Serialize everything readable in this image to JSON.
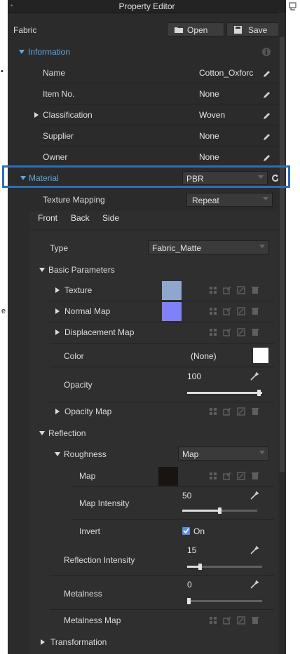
{
  "title": "Property Editor",
  "fabric_label": "Fabric",
  "open_label": "Open",
  "save_label": "Save",
  "information": {
    "header": "Information",
    "fields": [
      {
        "label": "Name",
        "value": "Cotton_Oxforc"
      },
      {
        "label": "Item No.",
        "value": "None"
      },
      {
        "label": "Classification",
        "value": "Woven"
      },
      {
        "label": "Supplier",
        "value": "None"
      },
      {
        "label": "Owner",
        "value": "None"
      }
    ]
  },
  "material": {
    "header": "Material",
    "value": "PBR",
    "texture_mapping_label": "Texture Mapping",
    "texture_mapping_value": "Repeat",
    "tabs": [
      "Front",
      "Back",
      "Side"
    ],
    "type_label": "Type",
    "type_value": "Fabric_Matte"
  },
  "basic_parameters": {
    "header": "Basic Parameters",
    "texture_label": "Texture",
    "texture_color": "#8fa7cc",
    "normal_map_label": "Normal Map",
    "normal_map_color": "#8080f8",
    "displacement_map_label": "Displacement Map",
    "color_label": "Color",
    "color_value": "(None)",
    "color_swatch": "#ffffff",
    "opacity_label": "Opacity",
    "opacity_value": "100",
    "opacity_map_label": "Opacity Map"
  },
  "reflection": {
    "header": "Reflection",
    "roughness_label": "Roughness",
    "roughness_value": "Map",
    "map_label": "Map",
    "map_color": "#1a1410",
    "map_intensity_label": "Map Intensity",
    "map_intensity_value": "50",
    "invert_label": "Invert",
    "invert_value": "On",
    "reflection_intensity_label": "Reflection Intensity",
    "reflection_intensity_value": "15",
    "metalness_label": "Metalness",
    "metalness_value": "0",
    "metalness_map_label": "Metalness Map"
  },
  "transformation_label": "Transformation",
  "side_chars": [
    "•",
    "e"
  ],
  "colors": {
    "panel_bg": "#2b2b2b",
    "accent_blue": "#5aa8e6",
    "highlight_border": "#2f6db4"
  }
}
